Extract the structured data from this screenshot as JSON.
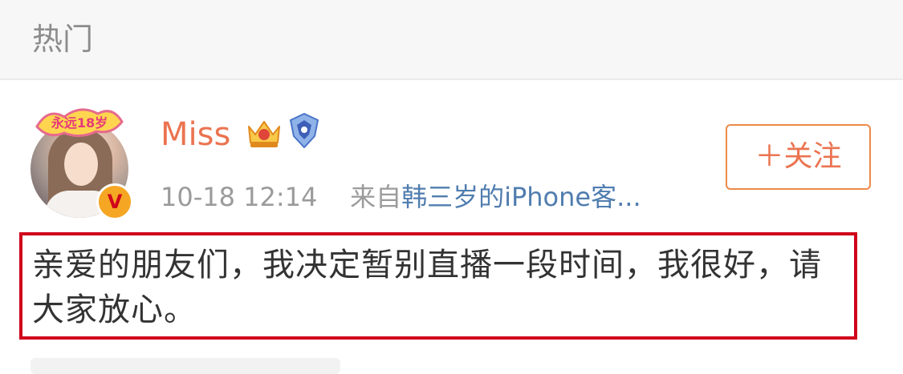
{
  "section": {
    "title": "热门"
  },
  "post": {
    "avatar_frame_text": "永远18岁",
    "verified_mark": "V",
    "author": "Miss",
    "crown_badge": "crown-icon",
    "rank_badge": "rank-icon",
    "timestamp": "10-18 12:14",
    "source_prefix": "来自",
    "source": "韩三岁的iPhone客...",
    "follow_label": "＋关注",
    "text": "亲爱的朋友们，我决定暂别直播一段时间，我很好，请大家放心。"
  },
  "colors": {
    "accent": "#eb7350",
    "link": "#507daf",
    "highlight": "#d0021b",
    "muted": "#9b9b9b"
  }
}
